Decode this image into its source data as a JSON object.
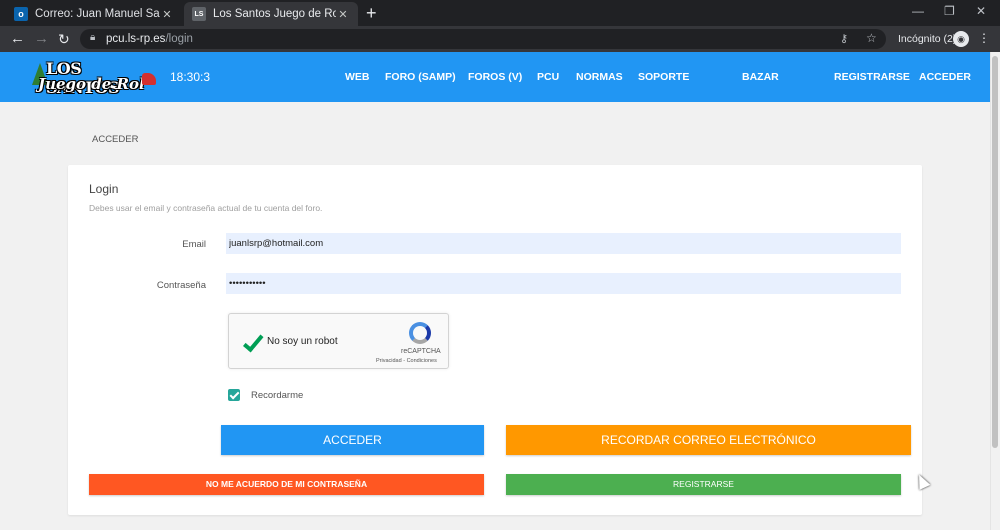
{
  "browser": {
    "tabs": [
      {
        "title": "Correo: Juan Manuel Santiago Ro",
        "icon": "outlook-icon",
        "favicon_text": "o",
        "active": false
      },
      {
        "title": "Los Santos Juego de Rol",
        "icon": "site-favicon",
        "favicon_text": "LS",
        "active": true
      }
    ],
    "url_host": "pcu.ls-rp.es",
    "url_path": "/login",
    "incognito_label": "Incógnito (2)"
  },
  "header": {
    "logo_line1": "LOS SANTOS",
    "logo_line2": "Juego de Rol",
    "clock": "18:30:3",
    "nav": [
      "WEB",
      "FORO (SAMP)",
      "FOROS (V)",
      "PCU",
      "NORMAS",
      "SOPORTE",
      "BAZAR",
      "REGISTRARSE",
      "ACCEDER"
    ],
    "color": "#2196f3"
  },
  "breadcrumb": "ACCEDER",
  "login": {
    "title": "Login",
    "subtitle": "Debes usar el email y contraseña actual de tu cuenta del foro.",
    "email_label": "Email",
    "email_value": "juanlsrp@hotmail.com",
    "password_label": "Contraseña",
    "password_value": "•••••••••••",
    "captcha_label": "No soy un robot",
    "captcha_brand": "reCAPTCHA",
    "captcha_links": "Privacidad - Condiciones",
    "remember_label": "Recordarme",
    "remember_checked": true
  },
  "buttons": {
    "acceder": "ACCEDER",
    "recordar": "RECORDAR CORREO ELECTRÓNICO",
    "olvido": "NO ME ACUERDO DE MI CONTRASEÑA",
    "registro": "REGISTRARSE"
  }
}
